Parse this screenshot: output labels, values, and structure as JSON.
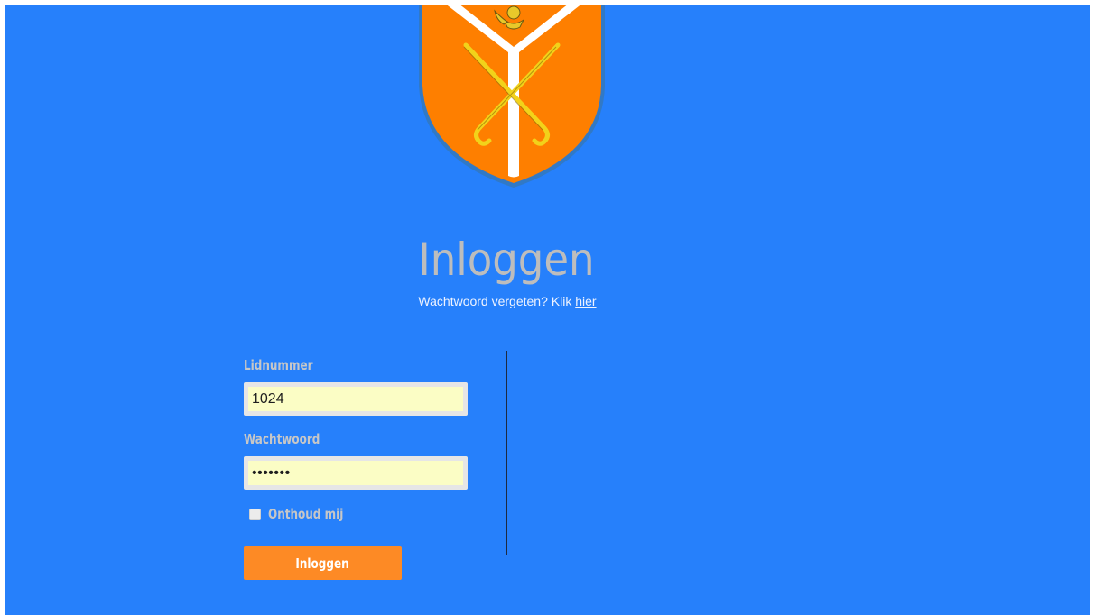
{
  "login": {
    "title": "Inloggen",
    "forgot_text": "Wachtwoord vergeten? Klik",
    "forgot_link": "hier",
    "member_label": "Lidnummer",
    "member_value": "1024",
    "password_label": "Wachtwoord",
    "password_value": "1234567",
    "remember_label": "Onthoud mij",
    "remember_checked": false,
    "submit_label": "Inloggen"
  },
  "icons": {
    "crest": "club-crest-logo",
    "remember": "checkbox-icon"
  },
  "colors": {
    "background": "#2680fb",
    "title": "#bdbdbd",
    "label": "#c7c7c7",
    "input_fill": "#fbfdc5",
    "button": "#fd8a25",
    "crest_orange": "#fe7f00",
    "crest_gold": "#f8dc1e"
  }
}
